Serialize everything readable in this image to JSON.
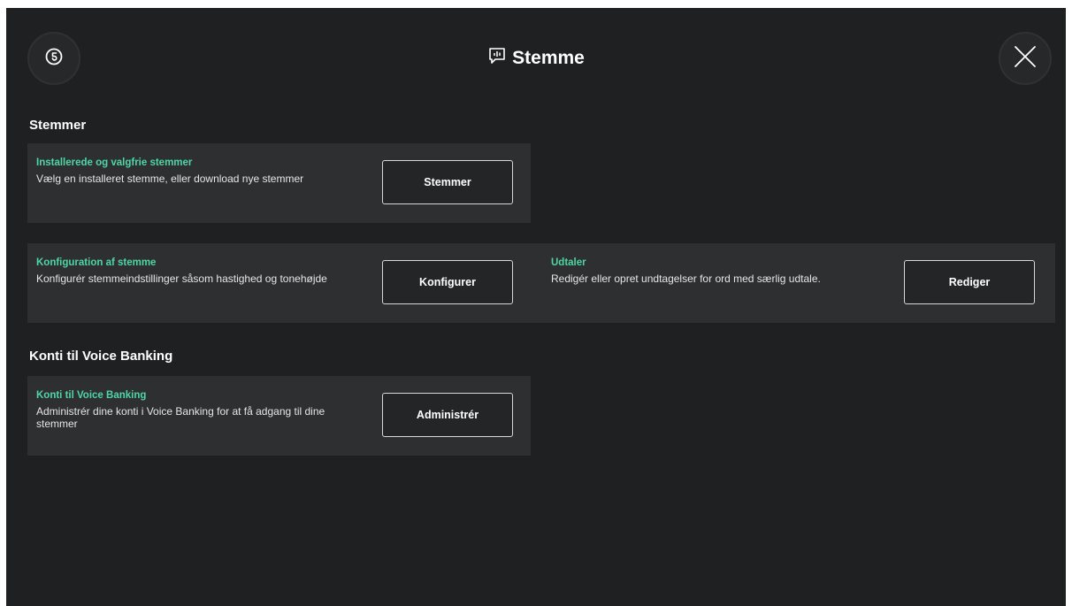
{
  "header": {
    "title": "Stemme",
    "back_icon": "reset-circle-icon",
    "title_icon": "speech-bubble-icon",
    "close_icon": "close-icon"
  },
  "colors": {
    "background": "#1e2021",
    "card": "#2e2f30",
    "accent": "#4fd6a6",
    "button_border": "#d8d8d8"
  },
  "sections": {
    "voices": {
      "heading": "Stemmer",
      "installed": {
        "title": "Installerede og valgfrie stemmer",
        "description": "Vælg en installeret stemme, eller download nye stemmer",
        "button": "Stemmer"
      },
      "config": {
        "title": "Konfiguration af stemme",
        "description": "Konfigurér stemmeindstillinger såsom hastighed og tonehøjde",
        "button": "Konfigurer"
      },
      "pronunciation": {
        "title": "Udtaler",
        "description": "Redigér eller opret undtagelser for ord med særlig udtale.",
        "button": "Rediger"
      }
    },
    "voice_banking": {
      "heading": "Konti til Voice Banking",
      "accounts": {
        "title": "Konti til Voice Banking",
        "description": "Administrér dine konti i Voice Banking for at få adgang til dine stemmer",
        "button": "Administrér"
      }
    }
  }
}
